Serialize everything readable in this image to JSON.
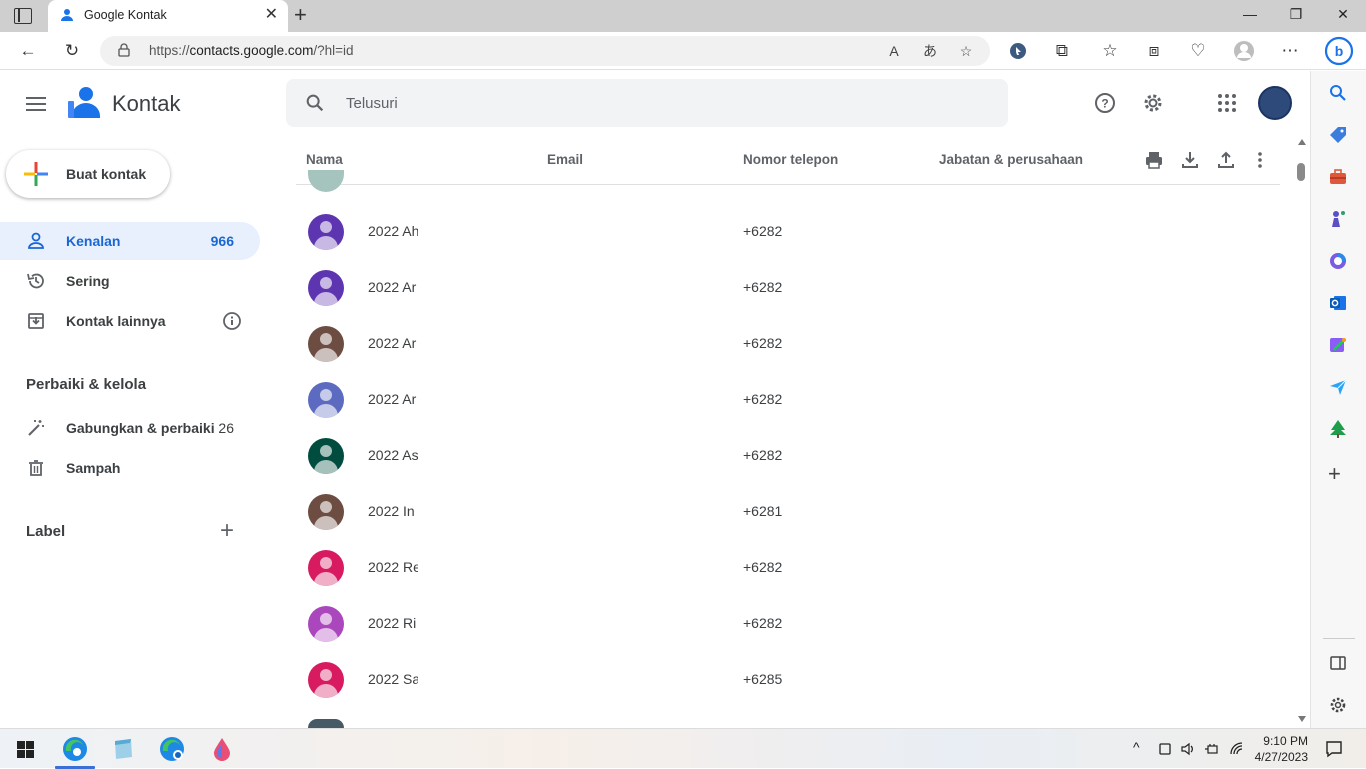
{
  "browser": {
    "tab_title": "Google Kontak",
    "url_prefix": "https://",
    "url_host": "contacts.google.com",
    "url_path": "/?hl=id",
    "window_controls": {
      "minimize": "—",
      "restore": "❐",
      "close": "✕"
    }
  },
  "header": {
    "app_name": "Kontak",
    "search_placeholder": "Telusuri"
  },
  "sidebar": {
    "create_label": "Buat kontak",
    "items": [
      {
        "label": "Kenalan",
        "count": "966",
        "icon": "person-icon",
        "active": true
      },
      {
        "label": "Sering",
        "icon": "history-icon"
      },
      {
        "label": "Kontak lainnya",
        "icon": "archive-icon"
      }
    ],
    "manage_title": "Perbaiki & kelola",
    "manage_items": [
      {
        "label": "Gabungkan & perbaiki",
        "count": "26",
        "icon": "magic-wand-icon"
      },
      {
        "label": "Sampah",
        "icon": "trash-icon"
      }
    ],
    "labels_title": "Label"
  },
  "list": {
    "columns": [
      "Nama",
      "Email",
      "Nomor telepon",
      "Jabatan & perusahaan"
    ],
    "rows": [
      {
        "name": "2022 Ah",
        "phone": "+6282",
        "color": "#5e35b1"
      },
      {
        "name": "2022 Ar",
        "phone": "+6282",
        "color": "#5e35b1"
      },
      {
        "name": "2022 Ar",
        "phone": "+6282",
        "color": "#6d4c41"
      },
      {
        "name": "2022 Ar",
        "phone": "+6282",
        "color": "#5c6bc0"
      },
      {
        "name": "2022 As",
        "phone": "+6282",
        "color": "#004d40"
      },
      {
        "name": "2022 In",
        "phone": "+6281",
        "color": "#6d4c41"
      },
      {
        "name": "2022 Re",
        "phone": "+6282",
        "color": "#d81b60"
      },
      {
        "name": "2022 Ri",
        "phone": "+6282",
        "color": "#ab47bc"
      },
      {
        "name": "2022 Sa",
        "phone": "+6285",
        "color": "#d81b60"
      }
    ]
  },
  "taskbar": {
    "time": "9:10 PM",
    "date": "4/27/2023"
  },
  "colors": {
    "accent": "#1967d2",
    "active_bg": "#e8f0fe"
  }
}
